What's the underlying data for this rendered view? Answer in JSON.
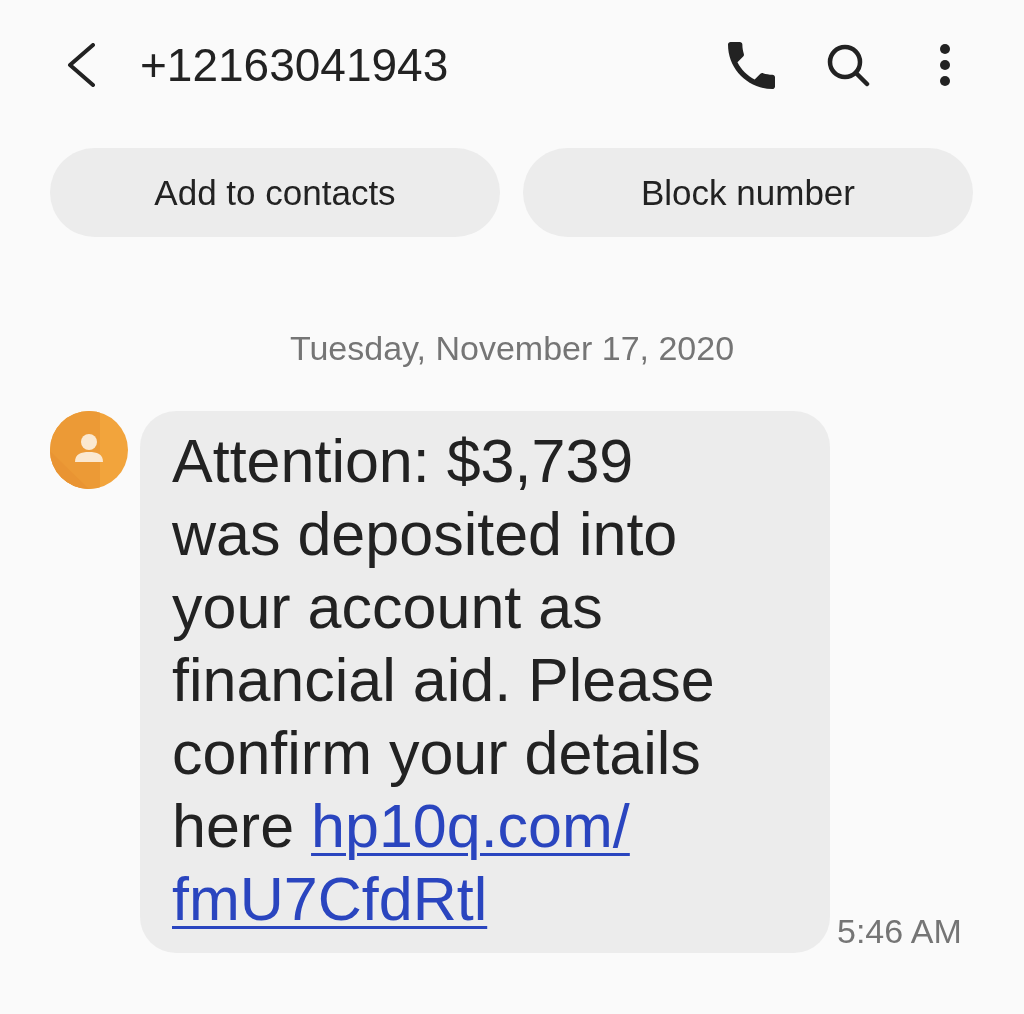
{
  "header": {
    "title": "+12163041943"
  },
  "actions": [
    {
      "label": "Add to contacts"
    },
    {
      "label": "Block number"
    }
  ],
  "date_divider": "Tuesday, November 17, 2020",
  "message": {
    "text": "Attention: $3,739 was deposited into your account as financial aid. Please confirm your details here",
    "link_lines": [
      "hp10q.com/",
      "fmU7CfdRtl"
    ],
    "time": "5:46 AM"
  }
}
